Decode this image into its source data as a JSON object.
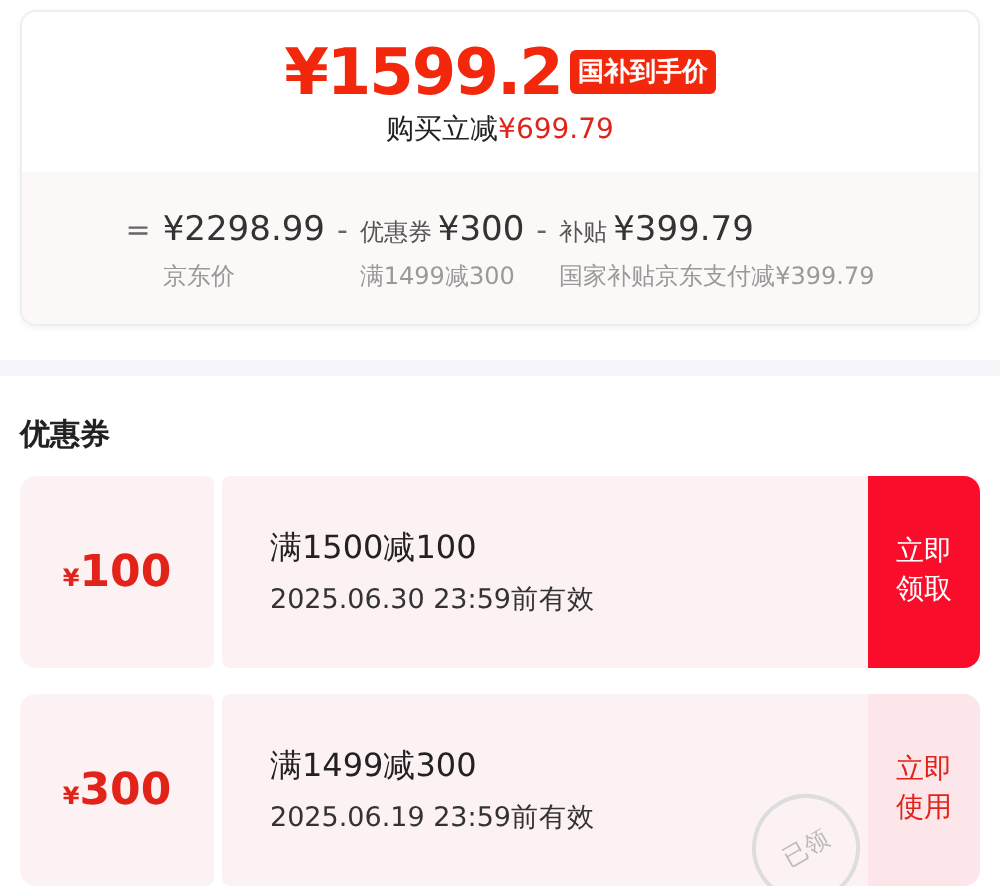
{
  "price_card": {
    "final_price": "¥1599.2",
    "badge": "国补到手价",
    "saving_label": "购买立减",
    "saving_amount": "¥699.79",
    "breakdown": [
      {
        "operator": "=",
        "amount": "¥2298.99",
        "note": "京东价"
      },
      {
        "operator": "-",
        "label": "优惠券",
        "amount": "¥300",
        "note": "满1499减300"
      },
      {
        "operator": "-",
        "label": "补贴",
        "amount": "¥399.79",
        "note": "国家补贴京东支付减¥399.79"
      }
    ]
  },
  "coupons_section": {
    "title": "优惠券",
    "coupons": [
      {
        "currency": "¥",
        "value": "100",
        "condition": "满1500减100",
        "validity": "2025.06.30 23:59前有效",
        "action": "立即领取",
        "claimed": false
      },
      {
        "currency": "¥",
        "value": "300",
        "condition": "满1499减300",
        "validity": "2025.06.19 23:59前有效",
        "action": "立即使用",
        "claimed": true,
        "stamp": "已领"
      }
    ]
  }
}
